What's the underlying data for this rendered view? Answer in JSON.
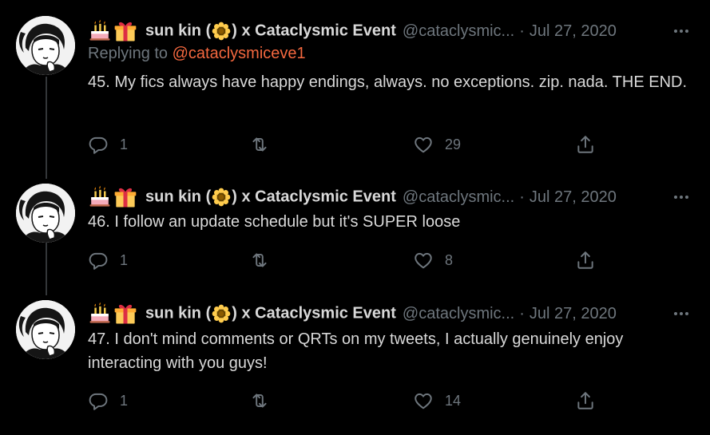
{
  "tweets": [
    {
      "display_name_prefix": "sun kin (",
      "display_name_suffix": ") x Cataclysmic Event",
      "handle": "@cataclysmic...",
      "separator": "·",
      "date": "Jul 27, 2020",
      "replying_label": "Replying to",
      "replying_to": "@cataclysmiceve1",
      "text": "45. My fics always have happy endings, always. no exceptions. zip. nada. THE END.",
      "replies": "1",
      "retweets": "",
      "likes": "29"
    },
    {
      "display_name_prefix": "sun kin (",
      "display_name_suffix": ") x Cataclysmic Event",
      "handle": "@cataclysmic...",
      "separator": "·",
      "date": "Jul 27, 2020",
      "text": "46. I follow an update schedule but it's SUPER loose",
      "replies": "1",
      "retweets": "",
      "likes": "8"
    },
    {
      "display_name_prefix": "sun kin (",
      "display_name_suffix": ") x Cataclysmic Event",
      "handle": "@cataclysmic...",
      "separator": "·",
      "date": "Jul 27, 2020",
      "text": "47. I don't mind comments or QRTs on my tweets, I actually genuinely enjoy interacting with you guys!",
      "replies": "1",
      "retweets": "",
      "likes": "14"
    }
  ],
  "icons": {
    "emoji_1": "birthday-cake-icon",
    "emoji_2": "gift-icon",
    "name_emoji": "sunflower-icon",
    "reply": "reply-icon",
    "retweet": "retweet-icon",
    "like": "heart-icon",
    "share": "share-icon",
    "more": "more-icon"
  },
  "colors": {
    "background": "#000000",
    "text": "#d9d9d9",
    "secondary": "#6e767d",
    "mention": "#f4683f",
    "thread_line": "#333639"
  }
}
